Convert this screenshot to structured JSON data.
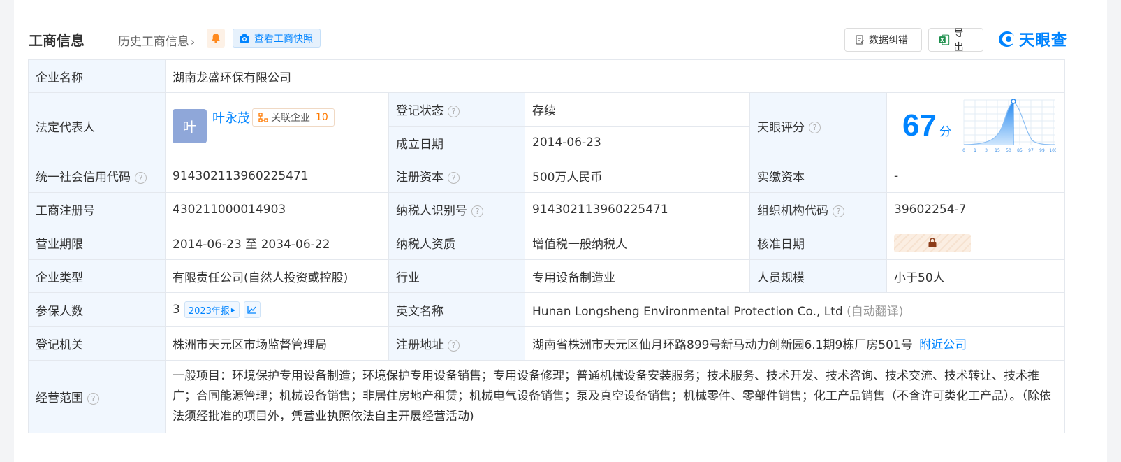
{
  "header": {
    "title": "工商信息",
    "history": "历史工商信息",
    "snapshot": "查看工商快照",
    "correct": "数据纠错",
    "export": "导出",
    "brand": "天眼查"
  },
  "rows": {
    "company_name_label": "企业名称",
    "company_name": "湖南龙盛环保有限公司",
    "legal_rep_label": "法定代表人",
    "legal_rep_avatar": "叶",
    "legal_rep_name": "叶永茂",
    "related_label": "关联企业",
    "related_count": "10",
    "reg_status_label": "登记状态",
    "reg_status": "存续",
    "est_date_label": "成立日期",
    "est_date": "2014-06-23",
    "tianyan_score_label": "天眼评分",
    "score": "67",
    "score_unit": "分",
    "score_ticks": [
      "0",
      "1",
      "3",
      "15",
      "50",
      "85",
      "97",
      "99",
      "100"
    ],
    "credit_code_label": "统一社会信用代码",
    "credit_code": "914302113960225471",
    "reg_capital_label": "注册资本",
    "reg_capital": "500万人民币",
    "paid_capital_label": "实缴资本",
    "paid_capital": "-",
    "reg_no_label": "工商注册号",
    "reg_no": "430211000014903",
    "taxpayer_id_label": "纳税人识别号",
    "taxpayer_id": "914302113960225471",
    "org_code_label": "组织机构代码",
    "org_code": "39602254-7",
    "term_label": "营业期限",
    "term": "2014-06-23 至 2034-06-22",
    "tax_qual_label": "纳税人资质",
    "tax_qual": "增值税一般纳税人",
    "approve_date_label": "核准日期",
    "type_label": "企业类型",
    "type": "有限责任公司(自然人投资或控股)",
    "industry_label": "行业",
    "industry": "专用设备制造业",
    "staff_size_label": "人员规模",
    "staff_size": "小于50人",
    "insured_label": "参保人数",
    "insured": "3",
    "insured_year": "2023年报",
    "en_name_label": "英文名称",
    "en_name": "Hunan Longsheng Environmental Protection Co., Ltd",
    "en_name_note": "(自动翻译)",
    "authority_label": "登记机关",
    "authority": "株洲市天元区市场监督管理局",
    "address_label": "注册地址",
    "address": "湖南省株洲市天元区仙月环路899号新马动力创新园6.1期9栋厂房501号",
    "nearby": "附近公司",
    "scope_label": "经营范围",
    "scope": "一般项目：环境保护专用设备制造；环境保护专用设备销售；专用设备修理；普通机械设备安装服务；技术服务、技术开发、技术咨询、技术交流、技术转让、技术推广；合同能源管理；机械设备销售；非居住房地产租赁；机械电气设备销售；泵及真空设备销售；机械零件、零部件销售；化工产品销售（不含许可类化工产品）。（除依法须经批准的项目外，凭营业执照依法自主开展经营活动)"
  },
  "colors": {
    "accent": "#0084ff",
    "status_green": "#00a35a",
    "label_bg": "#f1f7fe"
  }
}
